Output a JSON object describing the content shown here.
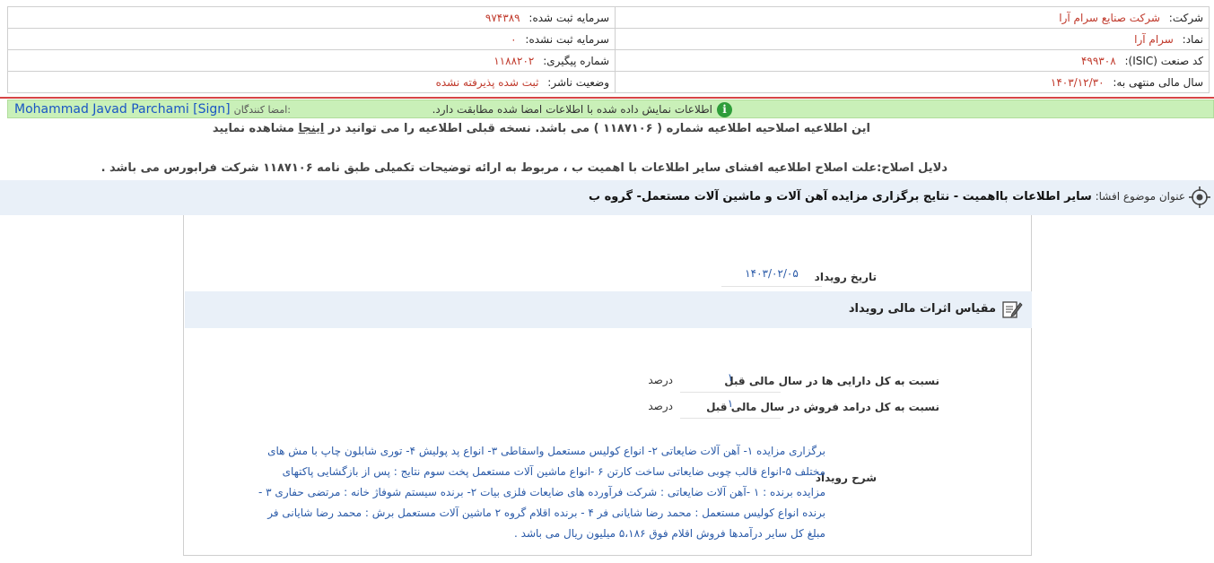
{
  "header": {
    "company_label": "شرکت:",
    "company_value": "شرکت صنایع سرام آرا",
    "capital_reg_label": "سرمایه ثبت شده:",
    "capital_reg_value": "۹۷۴۳۸۹",
    "symbol_label": "نماد:",
    "symbol_value": "سرام آرا",
    "capital_unreg_label": "سرمایه ثبت نشده:",
    "capital_unreg_value": "۰",
    "isic_label": "کد صنعت (ISIC):",
    "isic_value": "۴۹۹۳۰۸",
    "tracking_label": "شماره پیگیری:",
    "tracking_value": "۱۱۸۸۲۰۲",
    "fiscal_label": "سال مالی منتهی به:",
    "fiscal_value": "۱۴۰۳/۱۲/۳۰",
    "publisher_label": "وضعیت ناشر:",
    "publisher_value": "ثبت شده پذیرفته نشده"
  },
  "signature": {
    "message": "اطلاعات نمایش داده شده با اطلاعات امضا شده مطابقت دارد.",
    "info_icon_glyph": "i",
    "signers_label": "امضا کنندگان:",
    "signer_name": "Mohammad Javad Parchami [Sign]"
  },
  "notice": {
    "amend_before": "این اطلاعیه اصلاحیه اطلاعیه شماره ( ۱۱۸۷۱۰۶ ) می باشد. نسخه قبلی اطلاعیه را می توانید در",
    "amend_link": "اینجا",
    "amend_after": "مشاهده نمایید",
    "reason": "دلایل اصلاح:علت اصلاح اطلاعیه افشای سایر اطلاعات با اهمیت ب ، مربوط به ارائه توضیحات تکمیلی طبق نامه ۱۱۸۷۱۰۶ شرکت فرابورس می باشد ."
  },
  "subject": {
    "label": "عنوان موضوع افشا:",
    "value": "سایر اطلاعات بااهمیت - نتایج برگزاری مزایده آهن آلات و ماشین آلات مستعمل- گروه ب"
  },
  "event": {
    "date_label": "تاریخ رویداد",
    "date_value": "۱۴۰۳/۰۲/۰۵"
  },
  "financial": {
    "title": "مقیاس اثرات مالی رویداد",
    "rows": [
      {
        "label": "نسبت به کل دارایی ها در سال مالی قبل",
        "value": "۱",
        "unit": "درصد"
      },
      {
        "label": "نسبت به کل درامد فروش در سال مالی قبل",
        "value": "۱",
        "unit": "درصد"
      }
    ]
  },
  "description": {
    "label": "شرح رویداد",
    "text": "برگزاری مزایده ۱- آهن آلات ضایعاتی ۲- انواع کولیس مستعمل واسقاطی ۳- انواع پد پولیش ۴- توری شابلون چاپ با مش های مختلف ۵-انواع قالب چوبی ضایعاتی ساخت کارتن ۶ -انواع ماشین آلات مستعمل پخت سوم نتایج : پس از بازگشایی پاکتهای مزایده برنده : ۱ -آهن آلات ضایعاتی : شرکت فرآورده های ضایعات فلزی بیات ۲- برنده سیستم شوفاژ خانه : مرتضی حفاری ۳ - برنده انواع کولیس مستعمل : محمد رضا شایانی فر ۴ - برنده اقلام گروه ۲ ماشین آلات مستعمل برش : محمد رضا شایانی فر مبلغ کل سایر درآمدها فروش اقلام فوق ۵،۱۸۶ میلیون ریال می باشد ."
  },
  "colors": {
    "accent_red": "#c0392b",
    "success_bar": "#c9f0b8",
    "link_blue": "#1a56c4",
    "section_bg": "#e9f0f8"
  },
  "icons": {
    "info": "info-icon",
    "subject": "target-icon",
    "financial": "edit-document-icon"
  }
}
